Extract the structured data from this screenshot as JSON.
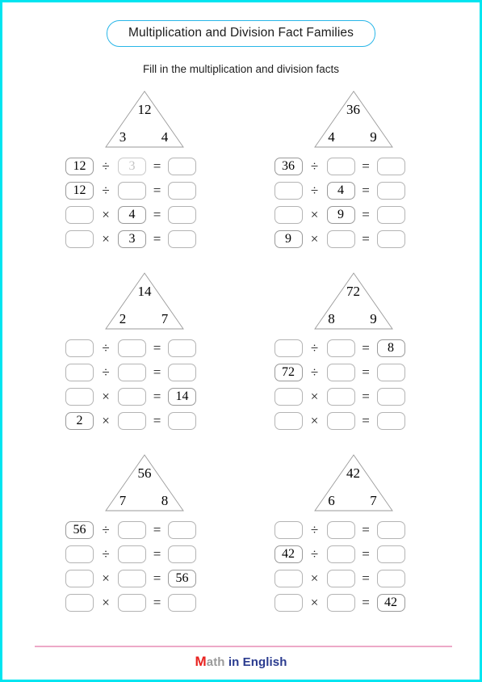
{
  "page": {
    "border_color": "#00e5f0",
    "background": "#ffffff"
  },
  "header": {
    "title": "Multiplication and Division Fact Families",
    "title_border_color": "#29b6e8",
    "instruction": "Fill in the multiplication and division facts"
  },
  "symbols": {
    "divide": "÷",
    "times": "×",
    "equals": "="
  },
  "problems": [
    {
      "id": "problem-1",
      "triangle": {
        "product": "12",
        "factor1": "3",
        "factor2": "4"
      },
      "rows": [
        {
          "a": "12",
          "op": "÷",
          "b": "3",
          "c": "",
          "a_state": "filled",
          "b_state": "faded",
          "c_state": "empty"
        },
        {
          "a": "12",
          "op": "÷",
          "b": "",
          "c": "",
          "a_state": "filled",
          "b_state": "empty",
          "c_state": "empty"
        },
        {
          "a": "",
          "op": "×",
          "b": "4",
          "c": "",
          "a_state": "empty",
          "b_state": "filled",
          "c_state": "empty"
        },
        {
          "a": "",
          "op": "×",
          "b": "3",
          "c": "",
          "a_state": "empty",
          "b_state": "filled",
          "c_state": "empty"
        }
      ]
    },
    {
      "id": "problem-2",
      "triangle": {
        "product": "36",
        "factor1": "4",
        "factor2": "9"
      },
      "rows": [
        {
          "a": "36",
          "op": "÷",
          "b": "",
          "c": "",
          "a_state": "filled",
          "b_state": "empty",
          "c_state": "empty"
        },
        {
          "a": "",
          "op": "÷",
          "b": "4",
          "c": "",
          "a_state": "empty",
          "b_state": "filled",
          "c_state": "empty"
        },
        {
          "a": "",
          "op": "×",
          "b": "9",
          "c": "",
          "a_state": "empty",
          "b_state": "filled",
          "c_state": "empty"
        },
        {
          "a": "9",
          "op": "×",
          "b": "",
          "c": "",
          "a_state": "filled",
          "b_state": "empty",
          "c_state": "empty"
        }
      ]
    },
    {
      "id": "problem-3",
      "triangle": {
        "product": "14",
        "factor1": "2",
        "factor2": "7"
      },
      "rows": [
        {
          "a": "",
          "op": "÷",
          "b": "",
          "c": "",
          "a_state": "empty",
          "b_state": "empty",
          "c_state": "empty"
        },
        {
          "a": "",
          "op": "÷",
          "b": "",
          "c": "",
          "a_state": "empty",
          "b_state": "empty",
          "c_state": "empty"
        },
        {
          "a": "",
          "op": "×",
          "b": "",
          "c": "14",
          "a_state": "empty",
          "b_state": "empty",
          "c_state": "filled"
        },
        {
          "a": "2",
          "op": "×",
          "b": "",
          "c": "",
          "a_state": "filled",
          "b_state": "empty",
          "c_state": "empty"
        }
      ]
    },
    {
      "id": "problem-4",
      "triangle": {
        "product": "72",
        "factor1": "8",
        "factor2": "9"
      },
      "rows": [
        {
          "a": "",
          "op": "÷",
          "b": "",
          "c": "8",
          "a_state": "empty",
          "b_state": "empty",
          "c_state": "filled"
        },
        {
          "a": "72",
          "op": "÷",
          "b": "",
          "c": "",
          "a_state": "filled",
          "b_state": "empty",
          "c_state": "empty"
        },
        {
          "a": "",
          "op": "×",
          "b": "",
          "c": "",
          "a_state": "empty",
          "b_state": "empty",
          "c_state": "empty"
        },
        {
          "a": "",
          "op": "×",
          "b": "",
          "c": "",
          "a_state": "empty",
          "b_state": "empty",
          "c_state": "empty"
        }
      ]
    },
    {
      "id": "problem-5",
      "triangle": {
        "product": "56",
        "factor1": "7",
        "factor2": "8"
      },
      "rows": [
        {
          "a": "56",
          "op": "÷",
          "b": "",
          "c": "",
          "a_state": "filled",
          "b_state": "empty",
          "c_state": "empty"
        },
        {
          "a": "",
          "op": "÷",
          "b": "",
          "c": "",
          "a_state": "empty",
          "b_state": "empty",
          "c_state": "empty"
        },
        {
          "a": "",
          "op": "×",
          "b": "",
          "c": "56",
          "a_state": "empty",
          "b_state": "empty",
          "c_state": "filled"
        },
        {
          "a": "",
          "op": "×",
          "b": "",
          "c": "",
          "a_state": "empty",
          "b_state": "empty",
          "c_state": "empty"
        }
      ]
    },
    {
      "id": "problem-6",
      "triangle": {
        "product": "42",
        "factor1": "6",
        "factor2": "7"
      },
      "rows": [
        {
          "a": "",
          "op": "÷",
          "b": "",
          "c": "",
          "a_state": "empty",
          "b_state": "empty",
          "c_state": "empty"
        },
        {
          "a": "42",
          "op": "÷",
          "b": "",
          "c": "",
          "a_state": "filled",
          "b_state": "empty",
          "c_state": "empty"
        },
        {
          "a": "",
          "op": "×",
          "b": "",
          "c": "",
          "a_state": "empty",
          "b_state": "empty",
          "c_state": "empty"
        },
        {
          "a": "",
          "op": "×",
          "b": "",
          "c": "42",
          "a_state": "empty",
          "b_state": "empty",
          "c_state": "filled"
        }
      ]
    }
  ],
  "footer": {
    "rule_color": "#eda9c8",
    "logo_part1": "M",
    "logo_part2": "ath",
    "logo_part3": " in English",
    "logo_color1": "#e8221f",
    "logo_color2": "#9b9b9b",
    "logo_color3": "#2a3b8f"
  }
}
